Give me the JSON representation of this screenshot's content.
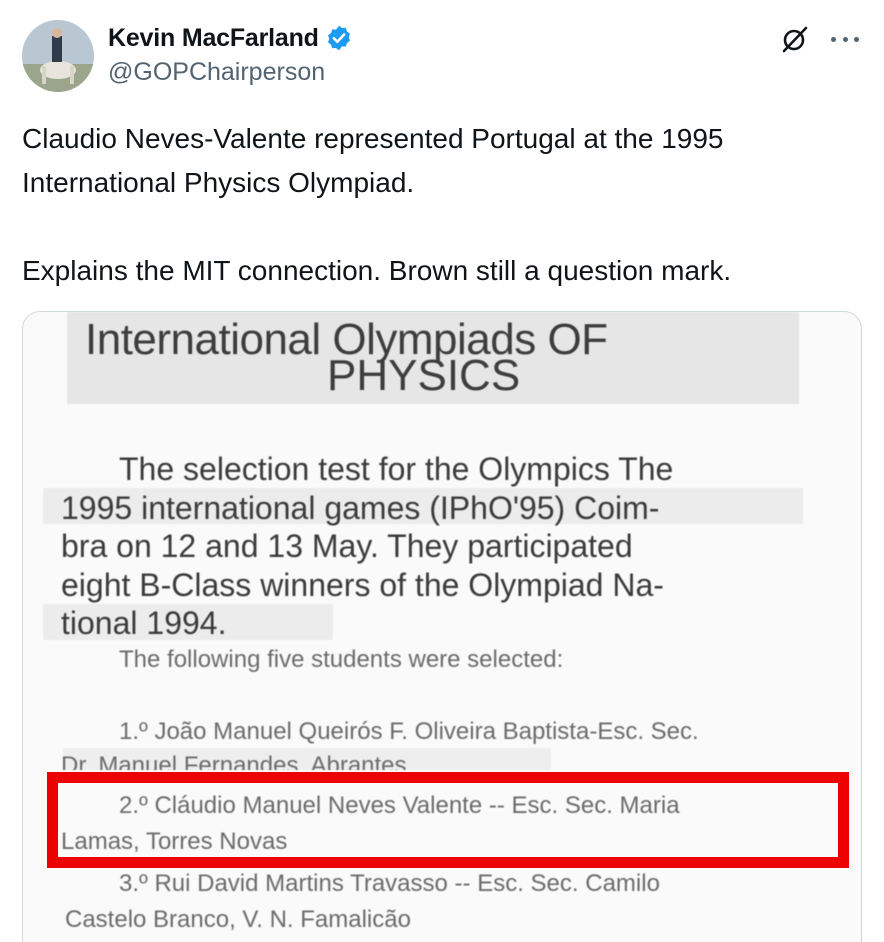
{
  "author": {
    "display_name": "Kevin MacFarland",
    "handle": "@GOPChairperson",
    "verified": true,
    "verified_color": "#1d9bf0"
  },
  "icons": {
    "grok": "grok-icon",
    "more": "more-options-icon",
    "verified": "verified-badge-icon"
  },
  "tweet": {
    "line1": "Claudio Neves-Valente represented Portugal at the 1995",
    "line2": "International Physics Olympiad.",
    "line3": "Explains the MIT connection. Brown still a question mark."
  },
  "media": {
    "title": "International Olympiads OF",
    "subtitle": "PHYSICS",
    "paragraph": [
      "The selection test for the Olympics The",
      "1995 international games (IPhO'95)  Coim-",
      "bra on 12 and 13 May. They participated",
      "eight B-Class winners of the Olympiad Na-",
      "tional 1994."
    ],
    "selected_heading": "The following five students were selected:",
    "entry1_line1": "1.º João Manuel Queirós F. Oliveira Baptista-Esc. Sec.",
    "entry1_line2": "Dr. Manuel Fernandes, Abrantes",
    "entry2_line1": "2.º Cláudio Manuel Neves Valente -- Esc. Sec. Maria",
    "entry2_line2": "Lamas, Torres Novas",
    "entry3_line1": "3.º Rui David Martins Travasso -- Esc. Sec. Camilo",
    "entry3_line2": "Castelo Branco, V. N. Famalicão",
    "highlight_color": "#ec0000"
  }
}
